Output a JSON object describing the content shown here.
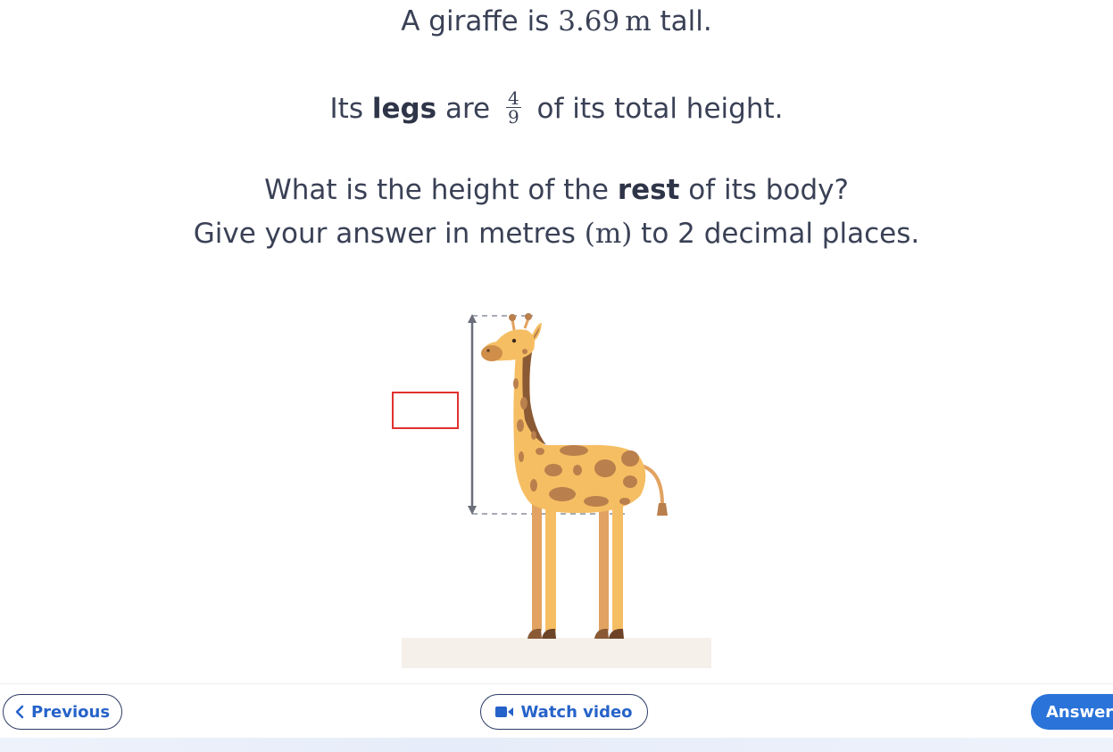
{
  "question": {
    "line1": {
      "pre": "A giraffe is ",
      "value": "3.69",
      "unit": "m",
      "post": " tall."
    },
    "line2": {
      "pre": "Its ",
      "bold": "legs",
      "mid": " are ",
      "fraction": {
        "numerator": "4",
        "denominator": "9"
      },
      "post": " of its total height."
    },
    "line3": {
      "pre": "What is the height of the ",
      "bold": "rest",
      "post": " of its body?"
    },
    "line4": {
      "pre": "Give your answer in metres ",
      "unit": "(m)",
      "post": " to 2 decimal places."
    }
  },
  "diagram": {
    "answer_box_value": "",
    "colors": {
      "answer_box_border": "#e0312e",
      "giraffe_body": "#f6be63",
      "giraffe_spots": "#b97f4c",
      "ground": "#f5f0ea"
    }
  },
  "footer": {
    "previous_label": "Previous",
    "watch_video_label": "Watch video",
    "answer_label": "Answer",
    "colors": {
      "link_blue": "#2663c9",
      "answer_button": "#2a73d9"
    }
  }
}
